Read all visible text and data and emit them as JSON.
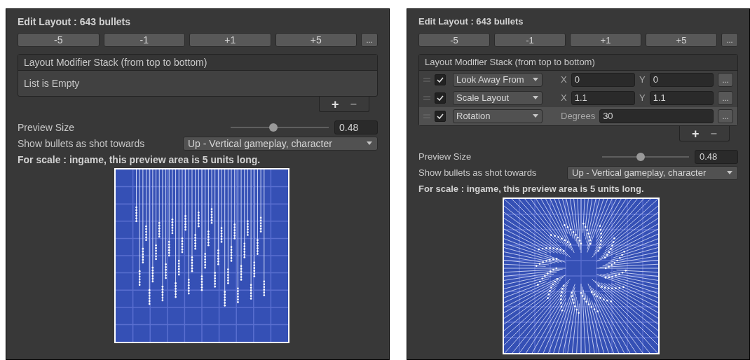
{
  "panels": [
    {
      "title": "Edit Layout : 643 bullets",
      "step_buttons": [
        "-5",
        "-1",
        "+1",
        "+5"
      ],
      "more_button": "...",
      "modifier_stack": {
        "title": "Layout Modifier Stack (from top to bottom)",
        "empty_text": "List is Empty",
        "add": "+",
        "remove": "−"
      },
      "preview_size": {
        "label": "Preview Size",
        "level": 0.43,
        "value": "0.48"
      },
      "shoot_direction": {
        "label": "Show bullets as shot towards",
        "value": "Up - Vertical gameplay, character"
      },
      "scale_note": "For scale : ingame, this preview area is 5 units long.",
      "preview": {
        "kind": "straight"
      }
    },
    {
      "title": "Edit Layout : 643 bullets",
      "step_buttons": [
        "-5",
        "-1",
        "+1",
        "+5"
      ],
      "more_button": "...",
      "modifier_stack": {
        "title": "Layout Modifier Stack (from top to bottom)",
        "modifiers": [
          {
            "name": "Look Away From",
            "checked": true,
            "selected": false,
            "fields": [
              {
                "label": "X",
                "value": "0"
              },
              {
                "label": "Y",
                "value": "0"
              }
            ],
            "more": "..."
          },
          {
            "name": "Scale Layout",
            "checked": true,
            "selected": false,
            "fields": [
              {
                "label": "X",
                "value": "1.1"
              },
              {
                "label": "Y",
                "value": "1.1"
              }
            ],
            "more": "..."
          },
          {
            "name": "Rotation",
            "checked": true,
            "selected": true,
            "fields": [
              {
                "label": "Degrees",
                "value": "30"
              }
            ],
            "more": "..."
          }
        ],
        "add": "+",
        "remove": "−"
      },
      "preview_size": {
        "label": "Preview Size",
        "level": 0.44,
        "value": "0.48"
      },
      "shoot_direction": {
        "label": "Show bullets as shot towards",
        "value": "Up - Vertical gameplay, character"
      },
      "scale_note": "For scale : ingame, this preview area is 5 units long.",
      "preview": {
        "kind": "radial"
      }
    }
  ]
}
